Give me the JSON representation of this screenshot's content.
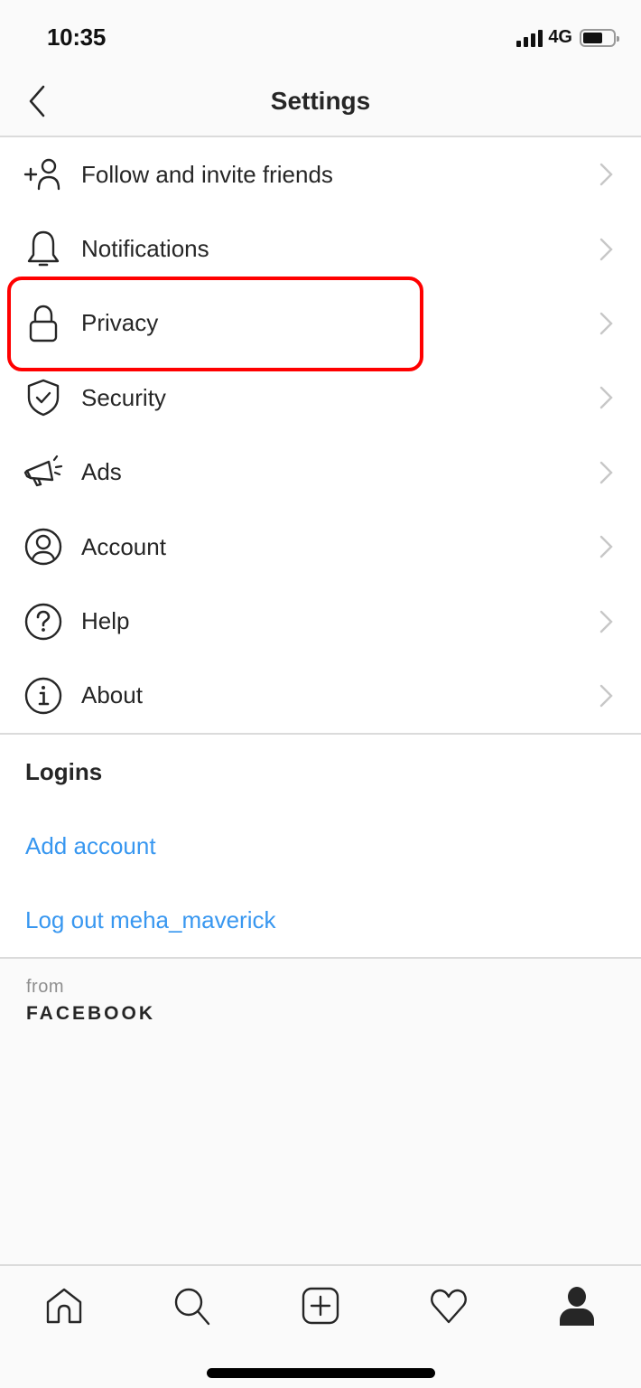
{
  "status_bar": {
    "time": "10:35",
    "network": "4G",
    "signal_bars": 4,
    "battery_percent": 65
  },
  "nav": {
    "title": "Settings",
    "back_icon": "chevron-left-icon"
  },
  "menu": {
    "items": [
      {
        "label": "Follow and invite friends",
        "icon": "add-person-icon"
      },
      {
        "label": "Notifications",
        "icon": "bell-icon"
      },
      {
        "label": "Privacy",
        "icon": "lock-icon",
        "highlighted": true
      },
      {
        "label": "Security",
        "icon": "shield-check-icon"
      },
      {
        "label": "Ads",
        "icon": "megaphone-icon"
      },
      {
        "label": "Account",
        "icon": "account-circle-icon"
      },
      {
        "label": "Help",
        "icon": "help-circle-icon"
      },
      {
        "label": "About",
        "icon": "info-circle-icon"
      }
    ]
  },
  "logins": {
    "header": "Logins",
    "add_account": "Add account",
    "log_out": "Log out meha_maverick"
  },
  "footer": {
    "from": "from",
    "brand": "FACEBOOK"
  },
  "tab_bar": {
    "tabs": [
      {
        "name": "home",
        "icon": "home-icon"
      },
      {
        "name": "search",
        "icon": "search-icon"
      },
      {
        "name": "new-post",
        "icon": "add-square-icon"
      },
      {
        "name": "activity",
        "icon": "heart-icon"
      },
      {
        "name": "profile",
        "icon": "profile-icon",
        "active": true
      }
    ]
  },
  "colors": {
    "link": "#3897f0",
    "highlight": "#ff0000",
    "text": "#262626",
    "chevron": "#c7c7c7"
  }
}
